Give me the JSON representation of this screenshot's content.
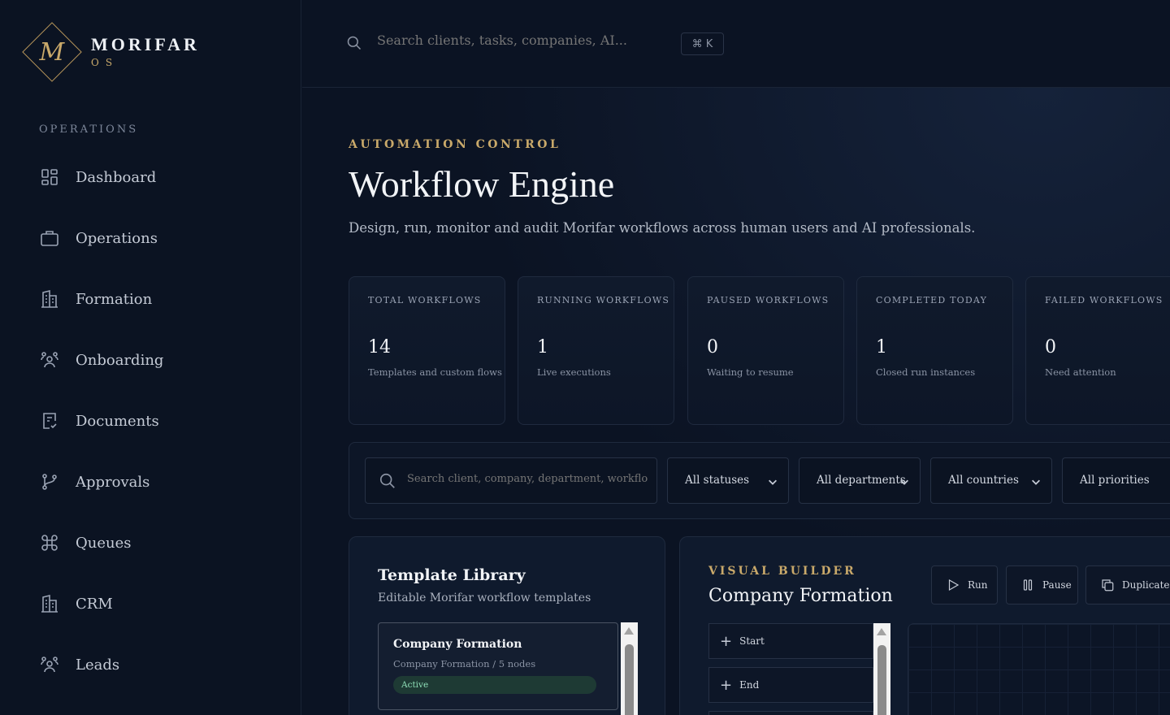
{
  "brand": {
    "monogram": "M",
    "name": "MORIFAR",
    "sub": "OS"
  },
  "sidebar": {
    "heading": "OPERATIONS",
    "items": [
      {
        "label": "Dashboard",
        "icon": "dashboard-grid-icon"
      },
      {
        "label": "Operations",
        "icon": "briefcase-icon"
      },
      {
        "label": "Formation",
        "icon": "building-icon"
      },
      {
        "label": "Onboarding",
        "icon": "users-icon"
      },
      {
        "label": "Documents",
        "icon": "document-check-icon"
      },
      {
        "label": "Approvals",
        "icon": "git-branch-icon"
      },
      {
        "label": "Queues",
        "icon": "command-icon"
      },
      {
        "label": "CRM",
        "icon": "building-icon"
      },
      {
        "label": "Leads",
        "icon": "users-icon"
      }
    ]
  },
  "topbar": {
    "search_placeholder": "Search clients, tasks, companies, AI...",
    "shortcut": "⌘ K"
  },
  "header": {
    "eyebrow": "AUTOMATION CONTROL",
    "title": "Workflow Engine",
    "subtitle": "Design, run, monitor and audit Morifar workflows across human users and AI professionals."
  },
  "stats": [
    {
      "label": "TOTAL WORKFLOWS",
      "value": "14",
      "desc": "Templates and custom flows"
    },
    {
      "label": "RUNNING WORKFLOWS",
      "value": "1",
      "desc": "Live executions"
    },
    {
      "label": "PAUSED WORKFLOWS",
      "value": "0",
      "desc": "Waiting to resume"
    },
    {
      "label": "COMPLETED TODAY",
      "value": "1",
      "desc": "Closed run instances"
    },
    {
      "label": "FAILED WORKFLOWS",
      "value": "0",
      "desc": "Need attention"
    }
  ],
  "filters": {
    "search_placeholder": "Search client, company, department, workflow, AI or h",
    "statuses": "All statuses",
    "departments": "All departments",
    "countries": "All countries",
    "priorities": "All priorities"
  },
  "library": {
    "title": "Template Library",
    "subtitle": "Editable Morifar workflow templates",
    "items": [
      {
        "name": "Company Formation",
        "meta": "Company Formation / 5 nodes",
        "status": "Active"
      }
    ]
  },
  "builder": {
    "eyebrow": "VISUAL BUILDER",
    "title": "Company Formation",
    "actions": {
      "run": "Run",
      "pause": "Pause",
      "duplicate": "Duplicate"
    },
    "nodes": [
      {
        "label": "Start"
      },
      {
        "label": "End"
      }
    ]
  }
}
